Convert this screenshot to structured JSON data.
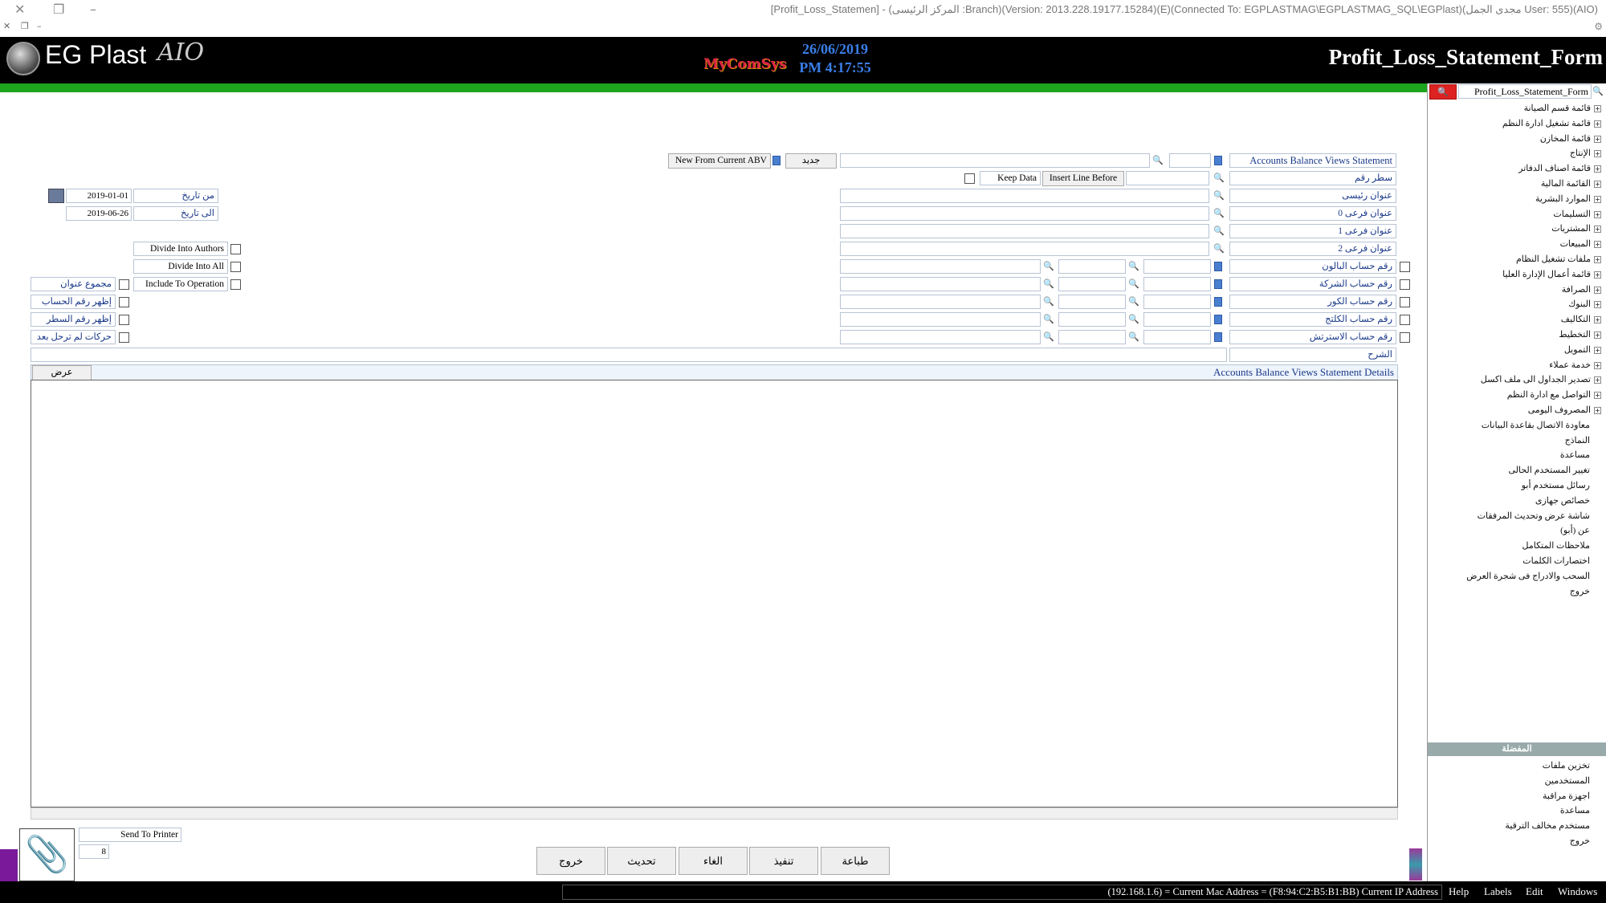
{
  "window": {
    "caption": "[Profit_Loss_Statemen] - (المركز الرئيسى :Branch)(Version: 2013.228.19177.15284)(E)(Connected To: EGPLASTMAG\\EGPLASTMAG_SQL\\EGPlast)(مجدى الجمل User: 555)(AIO)"
  },
  "header": {
    "logo": "EG Plast",
    "logo_suffix": "AIO",
    "vendor": "MyComSys",
    "date": "26/06/2019",
    "time": "PM 4:17:55",
    "form_title": "Profit_Loss_Statement_Form"
  },
  "search": {
    "value": "Profit_Loss_Statement_Form"
  },
  "form": {
    "abv_statement_label": "Accounts Balance Views Statement",
    "new_button": "جديد",
    "new_from_abv_button": "New From Current ABV",
    "line_no_label": "سطر رقم",
    "insert_line_before": "Insert Line Before",
    "keep_data": "Keep Data",
    "main_title_label": "عنوان رئيسى",
    "sub_title_0": "عنوان فرعى 0",
    "sub_title_1": "عنوان فرعى 1",
    "sub_title_2": "عنوان فرعى 2",
    "account_rows": [
      {
        "label": "رقم حساب البالون"
      },
      {
        "label": "رقم حساب الشركة"
      },
      {
        "label": "رقم حساب الكور"
      },
      {
        "label": "رقم حساب الكلتج"
      },
      {
        "label": "رقم حساب الاسترتش"
      }
    ],
    "description_label": "الشرح",
    "from_date_label": "من تاريخ",
    "from_date": "2019-01-01",
    "to_date_label": "الى تاريخ",
    "to_date": "2019-06-26",
    "options": {
      "divide_authors": "Divide Into Authors",
      "divide_all": "Divide Into All",
      "include_operation": "Include To Operation",
      "title_total": "مجموع عنوان",
      "show_account_no": "إظهر رقم الحساب",
      "show_line_no": "إظهر رقم السطر",
      "unposted": "حركات لم ترحل بعد"
    },
    "details_title": "Accounts Balance Views Statement Details",
    "show_button": "عرض"
  },
  "printer": {
    "option": "Send To Printer",
    "copies": "8"
  },
  "actions": {
    "print": "طباعة",
    "execute": "تنفيذ",
    "cancel": "الغاء",
    "refresh": "تحديث",
    "exit": "خروج"
  },
  "sidebar": {
    "items": [
      "قائمة قسم الصيانة",
      "قائمة تشغيل ادارة النظم",
      "قائمة المخازن",
      "الإنتاج",
      "قائمة اصناف الدفاتر",
      "القائمة المالية",
      "الموارد البشرية",
      "التسليمات",
      "المشتريات",
      "المبيعات",
      "ملفات تشغيل النظام",
      "قائمة أعمال الإدارة العليا",
      "الصرافة",
      "البنوك",
      "التكاليف",
      "التخطيط",
      "التمويل",
      "خدمة عملاء",
      "تصدير الجداول الى ملف اكسل",
      "التواصل مع ادارة النظم",
      "المصروف اليومى"
    ],
    "plain_items": [
      "معاودة الاتصال بقاعدة البيانات",
      "النماذج",
      "مساعدة",
      "تغيير المستخدم الحالى",
      "رسائل مستخدم أبو",
      "خصائص جهازى",
      "شاشة عرض وتحديث المرفقات",
      "عن (أبو)",
      "ملاحظات المتكامل",
      "اختصارات الكلمات",
      "السحب والادراج فى شجرة العرض",
      "خروج"
    ],
    "favorites_title": "المفضلة",
    "favorites": [
      "تخزين ملفات",
      "المستخدمين",
      "اجهزة مراقبة",
      "مساعدة",
      "مستخدم مخالف الترقية",
      "خروج"
    ]
  },
  "status": {
    "info": "(192.168.1.6) = Current Mac Address = (F8:94:C2:B5:B1:BB) Current IP Address",
    "menu": [
      "Help",
      "Labels",
      "Edit",
      "Windows"
    ]
  }
}
